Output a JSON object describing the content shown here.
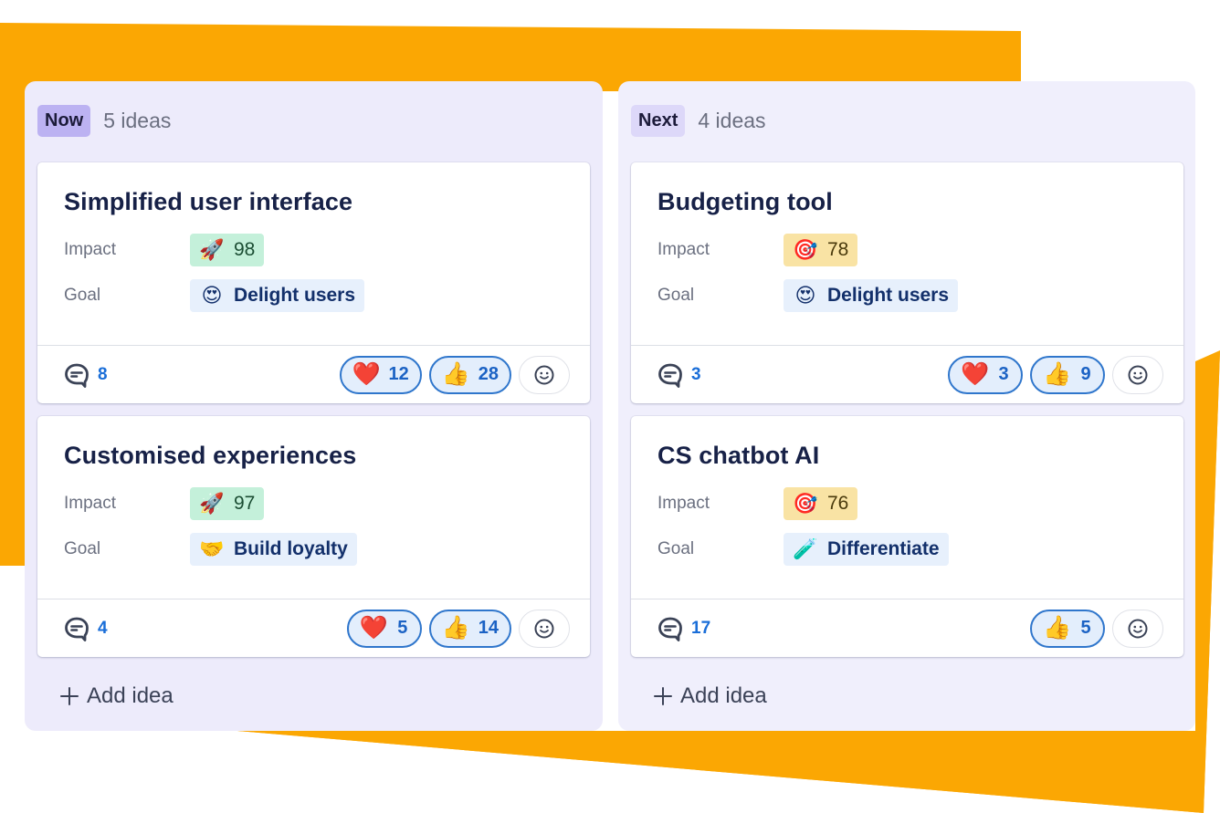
{
  "theme": {
    "accent_orange": "#fba703",
    "column_bg": "#edebfb",
    "reaction_border": "#2f76cc",
    "count_blue": "#1a6ed8"
  },
  "columns": [
    {
      "badge": "Now",
      "count": "5 ideas",
      "add_label": "Add idea",
      "cards": [
        {
          "title": "Simplified user interface",
          "impact_label": "Impact",
          "impact_icon": "rocket-icon",
          "impact_emoji": "🚀",
          "impact_value": "98",
          "goal_label": "Goal",
          "goal_icon": "heart-eyes-icon",
          "goal_emoji": "😍",
          "goal_value": "Delight users",
          "comments": "8",
          "reactions": [
            {
              "icon": "heart-icon",
              "emoji": "❤️",
              "count": "12"
            },
            {
              "icon": "thumbs-up-icon",
              "emoji": "👍",
              "count": "28"
            }
          ]
        },
        {
          "title": "Customised experiences",
          "impact_label": "Impact",
          "impact_icon": "rocket-icon",
          "impact_emoji": "🚀",
          "impact_value": "97",
          "goal_label": "Goal",
          "goal_icon": "handshake-icon",
          "goal_emoji": "🤝",
          "goal_value": "Build loyalty",
          "comments": "4",
          "reactions": [
            {
              "icon": "heart-icon",
              "emoji": "❤️",
              "count": "5"
            },
            {
              "icon": "thumbs-up-icon",
              "emoji": "👍",
              "count": "14"
            }
          ]
        }
      ]
    },
    {
      "badge": "Next",
      "count": "4 ideas",
      "add_label": "Add idea",
      "cards": [
        {
          "title": "Budgeting tool",
          "impact_label": "Impact",
          "impact_icon": "target-icon",
          "impact_emoji": "🎯",
          "impact_value": "78",
          "goal_label": "Goal",
          "goal_icon": "heart-eyes-icon",
          "goal_emoji": "😍",
          "goal_value": "Delight users",
          "comments": "3",
          "reactions": [
            {
              "icon": "heart-icon",
              "emoji": "❤️",
              "count": "3"
            },
            {
              "icon": "thumbs-up-icon",
              "emoji": "👍",
              "count": "9"
            }
          ]
        },
        {
          "title": "CS chatbot AI",
          "impact_label": "Impact",
          "impact_icon": "target-icon",
          "impact_emoji": "🎯",
          "impact_value": "76",
          "goal_label": "Goal",
          "goal_icon": "test-tube-icon",
          "goal_emoji": "🧪",
          "goal_value": "Differentiate",
          "comments": "17",
          "reactions": [
            {
              "icon": "thumbs-up-icon",
              "emoji": "👍",
              "count": "5"
            }
          ]
        }
      ]
    }
  ]
}
